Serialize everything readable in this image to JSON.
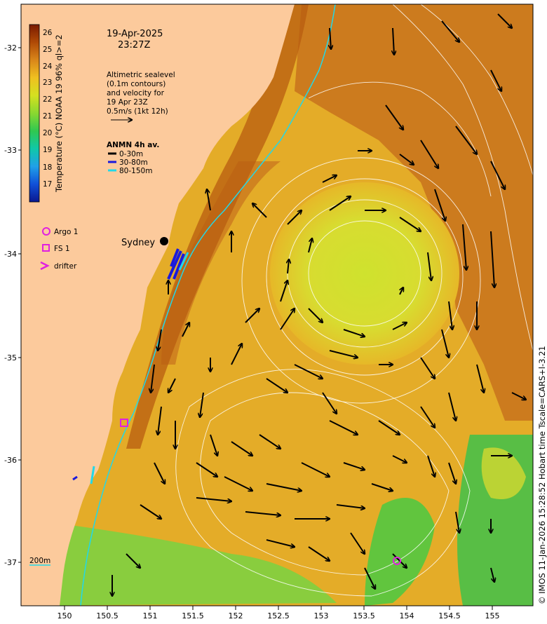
{
  "header": {
    "date": "19-Apr-2025",
    "time": "23:27Z"
  },
  "legend": {
    "altimetry_lines": [
      "Altimetric sealevel",
      "(0.1m contours)",
      "and velocity for",
      "19 Apr 23Z",
      "0.5m/s (1kt 12h)"
    ],
    "anmn_title": "ANMN 4h av.",
    "anmn_items": [
      {
        "label": "0-30m",
        "color": "#000000"
      },
      {
        "label": "30-80m",
        "color": "#1a1adc"
      },
      {
        "label": "80-150m",
        "color": "#22d8e8"
      }
    ],
    "markers": [
      {
        "label": "Argo 1",
        "symbol": "circle",
        "color": "#e020e0"
      },
      {
        "label": "FS 1",
        "symbol": "square",
        "color": "#e020e0"
      },
      {
        "label": "drifter",
        "symbol": "chevron",
        "color": "#e020e0"
      }
    ],
    "scale_label": "200m"
  },
  "colorbar": {
    "title": "Temperature (°C) NOAA 19 96% ql>=2",
    "ticks": [
      "26",
      "25",
      "24",
      "23",
      "22",
      "21",
      "20",
      "19",
      "18",
      "17"
    ],
    "colors": [
      "#7a1a00",
      "#b04a06",
      "#d9861a",
      "#f0c020",
      "#d4e020",
      "#8ad830",
      "#30c850",
      "#10c8a8",
      "#20a0e8",
      "#1050d8",
      "#0a1890"
    ]
  },
  "axes": {
    "x_ticks": [
      "150",
      "150.5",
      "151",
      "151.5",
      "152",
      "152.5",
      "153",
      "153.5",
      "154",
      "154.5",
      "155"
    ],
    "y_ticks": [
      "-32",
      "-33",
      "-34",
      "-35",
      "-36",
      "-37"
    ]
  },
  "place_label": "Sydney",
  "credit": "© IMOS 11-Jan-2026 15:28:52 Hobart time Tscale=CARS+l-3.21",
  "colors": {
    "land": "#fcca9c",
    "warm_ocean": "#c8721c",
    "mid_ocean": "#e4ac28",
    "eddy_core": "#d6e228",
    "cool_ocean": "#7ed040",
    "shelf_line": "#22d8e8"
  }
}
